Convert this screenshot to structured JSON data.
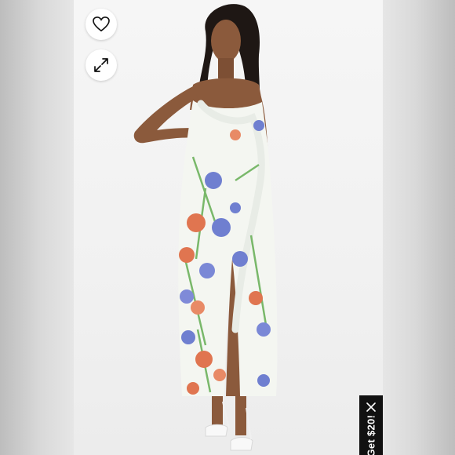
{
  "viewer": {
    "like_icon": "heart-outline-icon",
    "expand_icon": "expand-arrows-icon",
    "close_icon": "close-x-icon"
  },
  "promo": {
    "text": "Get $20!"
  },
  "colors": {
    "photo_background": "#f3f3f3",
    "promo_background": "#111111",
    "button_background": "#ffffff",
    "dress_base": "#f4f6f1",
    "print_blue": "#6f7fd0",
    "print_orange": "#e07550",
    "print_green": "#79b86a"
  }
}
